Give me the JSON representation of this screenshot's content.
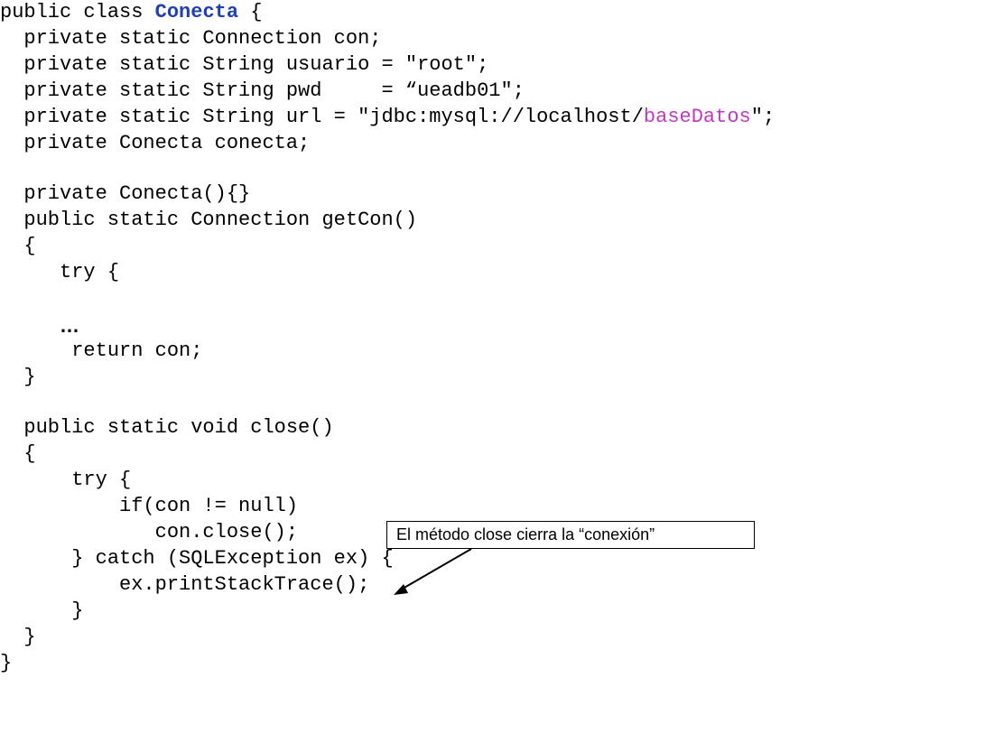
{
  "code": {
    "l1_a": "public class ",
    "l1_class": "Conecta",
    "l1_b": " {",
    "l2": "  private static Connection con;",
    "l3": "  private static String usuario = \"root\";",
    "l4": "  private static String pwd     = “ueadb01\";",
    "l5_a": "  private static String url = \"jdbc:mysql://localhost/",
    "l5_db": "baseDatos",
    "l5_b": "\";",
    "l6": "  private Conecta conecta;",
    "l7": "  private Conecta(){}",
    "l8": "  public static Connection getCon()",
    "l9": "  {",
    "l10": "     try {",
    "l11": "…",
    "l12": "      return con;",
    "l13": "  }",
    "l14": "  public static void close()",
    "l15": "  {",
    "l16": "      try {",
    "l17": "          if(con != null)",
    "l18": "             con.close();",
    "l19": "      } catch (SQLException ex) {",
    "l20": "          ex.printStackTrace();",
    "l21": "      }",
    "l22": "  }",
    "l23": "}"
  },
  "annotation": {
    "text": "El método close cierra la  “conexión”"
  }
}
